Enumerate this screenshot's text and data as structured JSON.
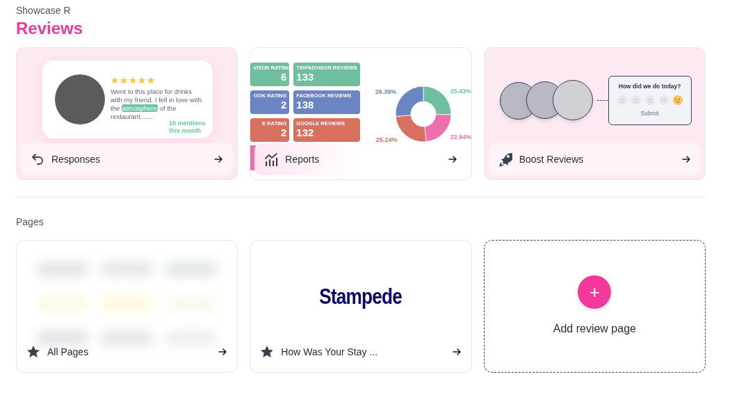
{
  "header": {
    "subtitle": "Showcase R",
    "title": "Reviews"
  },
  "feature_cards": [
    {
      "kind": "responses",
      "label": "Responses",
      "preview": {
        "stars": 5,
        "review_before": "Went to this place for drinks with my friend. I fell in love with the",
        "highlight": "atmosphere",
        "review_after": "of the restaurant.......",
        "mentions": "10 mentions this month"
      }
    },
    {
      "kind": "reports",
      "label": "Reports",
      "preview": {
        "tiles": [
          {
            "label": "VISOR RATING",
            "value": "6",
            "color": "#6fbf9f"
          },
          {
            "label": "TRIPADVISOR REVIEWS",
            "value": "133",
            "color": "#6fbf9f"
          },
          {
            "label": "OOK RATING",
            "value": "2",
            "color": "#6b84c2"
          },
          {
            "label": "FACEBOOK REVIEWS",
            "value": "138",
            "color": "#6b84c2"
          },
          {
            "label": "E RATING",
            "value": "2",
            "color": "#d8705f"
          },
          {
            "label": "GOOGLE REVIEWS",
            "value": "132",
            "color": "#d8705f"
          }
        ],
        "chart_data": {
          "type": "donut",
          "values": [
            25.43,
            22.94,
            25.24,
            26.39
          ],
          "value_labels": [
            "25.43%",
            "22.94%",
            "25.24%",
            "26.39%"
          ],
          "colors": [
            "#6fbf9f",
            "#ee6fad",
            "#d8705f",
            "#6b84c2"
          ],
          "data_labels": true
        }
      }
    },
    {
      "kind": "boost",
      "label": "Boost Reviews",
      "preview": {
        "question": "How did we do today?",
        "faces": [
          {
            "selected": false
          },
          {
            "selected": false
          },
          {
            "selected": false
          },
          {
            "selected": false
          },
          {
            "selected": true
          }
        ],
        "submit": "Submit"
      }
    }
  ],
  "pages_label": "Pages",
  "page_cards": [
    {
      "kind": "blurred",
      "label": "All Pages"
    },
    {
      "kind": "logo",
      "logo_text": "Stampede",
      "label": "How Was Your Stay ..."
    }
  ],
  "add_card": {
    "icon": "+",
    "label": "Add review page"
  }
}
